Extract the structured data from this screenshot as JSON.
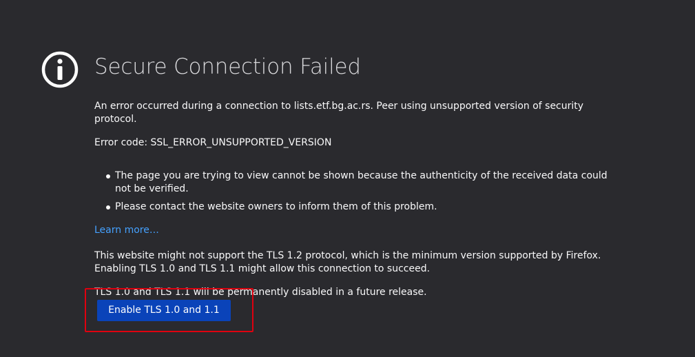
{
  "page": {
    "title": "Secure Connection Failed",
    "icon": "info-icon",
    "short_description": "An error occurred during a connection to lists.etf.bg.ac.rs. Peer using unsupported version of security protocol.",
    "error_code": "Error code: SSL_ERROR_UNSUPPORTED_VERSION",
    "reasons": [
      "The page you are trying to view cannot be shown because the authenticity of the received data could not be verified.",
      "Please contact the website owners to inform them of this problem."
    ],
    "learn_more": "Learn more…",
    "tls_advice": "This website might not support the TLS 1.2 protocol, which is the minimum version supported by Firefox. Enabling TLS 1.0 and TLS 1.1 might allow this connection to succeed.",
    "tls_future": "TLS 1.0 and TLS 1.1 will be permanently disabled in a future release.",
    "enable_button": "Enable TLS 1.0 and 1.1"
  },
  "colors": {
    "background": "#2a2a2e",
    "text": "#f9f9fa",
    "link": "#45a1ff",
    "button": "#0a43b9",
    "highlight": "#e0000f"
  }
}
